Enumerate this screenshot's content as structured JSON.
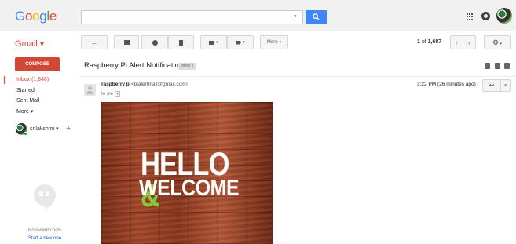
{
  "header": {
    "logo": "Google",
    "search": {
      "value": "",
      "placeholder": ""
    }
  },
  "toolbar": {
    "app_label": "Gmail",
    "more_label": "More",
    "pager_range": "1",
    "pager_of": "of",
    "pager_total": "1,687"
  },
  "sidebar": {
    "compose_label": "COMPOSE",
    "items": [
      {
        "label": "Inbox (1,848)"
      },
      {
        "label": "Starred"
      },
      {
        "label": "Sent Mail"
      },
      {
        "label": "More"
      }
    ],
    "user_name": "srilakshmi",
    "no_chats": "No recent chats",
    "start_chat": "Start a new one"
  },
  "message": {
    "subject": "Raspberry Pi Alert Notification",
    "tag": "Inbox",
    "sender_name": "raspberry pi",
    "sender_email": "<pialertmail@gmail.com>",
    "to": "to me",
    "timestamp": "3:22 PM (26 minutes ago)",
    "image_line1": "HELLO",
    "image_amp": "&",
    "image_line2": "WELCOME"
  },
  "colors": {
    "accent": "#dd4b39",
    "search_button": "#4285f4",
    "compose": "#d14836",
    "link": "#1155cc",
    "amp_green": "#8cc63f"
  }
}
